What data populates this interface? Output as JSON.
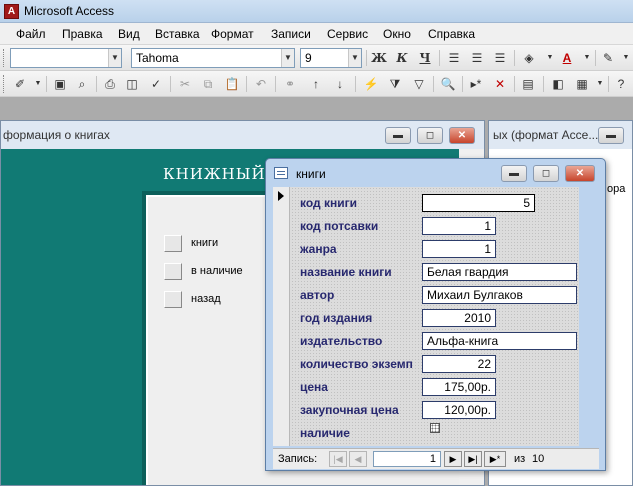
{
  "app": {
    "title": "Microsoft Access",
    "icon": "access-icon"
  },
  "menu": [
    {
      "label": "Файл"
    },
    {
      "label": "Правка"
    },
    {
      "label": "Вид"
    },
    {
      "label": "Вставка"
    },
    {
      "label": "Формат"
    },
    {
      "label": "Записи"
    },
    {
      "label": "Сервис"
    },
    {
      "label": "Окно"
    },
    {
      "label": "Справка"
    }
  ],
  "toolbar": {
    "object_combo": "",
    "font_name": "Tahoma",
    "font_size": "9",
    "bold": "Ж",
    "italic": "К",
    "underline": "Ч",
    "font_color_letter": "A"
  },
  "back_window_left": {
    "title": "формация о книгах",
    "heading": "КНИЖНЫЙ",
    "buttons": [
      {
        "label": "книги"
      },
      {
        "label": "в наличие"
      },
      {
        "label": "назад"
      }
    ]
  },
  "back_window_right": {
    "title": "ых (формат Acce...",
    "text": "ора"
  },
  "form": {
    "title": "книги",
    "fields": [
      {
        "label": "код книги",
        "value": "5"
      },
      {
        "label": "код потсавки",
        "value": "1"
      },
      {
        "label": "жанра",
        "value": "1"
      },
      {
        "label": "название книги",
        "value": "Белая гвардия"
      },
      {
        "label": "автор",
        "value": "Михаил Булгаков"
      },
      {
        "label": "год издания",
        "value": "2010"
      },
      {
        "label": "издательство",
        "value": "Альфа-книга"
      },
      {
        "label": "количество экземп",
        "value": "22"
      },
      {
        "label": "цена",
        "value": "175,00р."
      },
      {
        "label": "закупочная цена",
        "value": "120,00р."
      },
      {
        "label": "наличие",
        "value": ""
      }
    ],
    "nav": {
      "caption": "Запись:",
      "current": "1",
      "total_prefix": "из",
      "total": "10"
    }
  }
}
